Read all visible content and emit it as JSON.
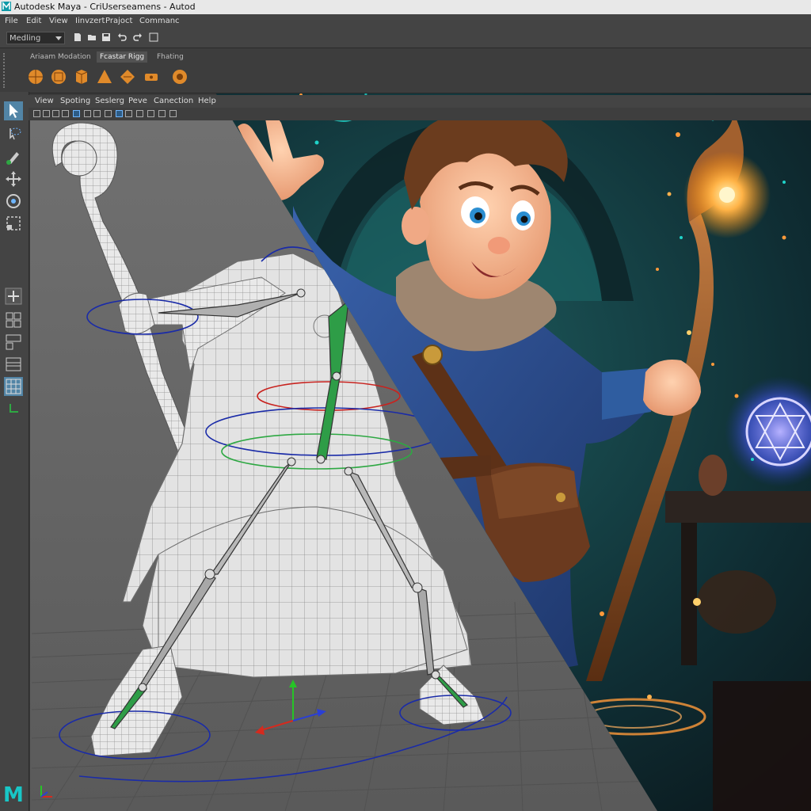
{
  "window": {
    "title": "Autodesk Maya - C:\\Users\\Name\\… - Autod",
    "display_title": "Autodesk Maya - CriUserseamens - Autod"
  },
  "menubar": {
    "items": [
      "File",
      "Edit",
      "View",
      "Iinvzert",
      "Prajoct",
      "Commanc"
    ]
  },
  "status_line": {
    "mode": "Medling"
  },
  "shelf": {
    "tabs": [
      "Ariaam Modation",
      "Fcastar Rigg",
      "Fhating"
    ],
    "active_tab": 1
  },
  "viewport_menu": {
    "items": [
      "View",
      "Spoting",
      "Seslerg",
      "Peve",
      "Canection",
      "Help"
    ]
  },
  "colors": {
    "maya_bg": "#444444",
    "viewport_bg": "#6b6b6b",
    "accent_blue": "#5285a6",
    "logo_cyan": "#18c7c7",
    "joint_green": "#2ea843",
    "ctrl_blue": "#1a2ba8",
    "ctrl_red": "#c8231f",
    "magic_teal": "#1fd3c9",
    "robe_blue": "#2a4a85",
    "staff_glow": "#ffb347"
  },
  "icons": {
    "toolbox": [
      "select-arrow-icon",
      "lasso-icon",
      "paint-select-icon",
      "move-icon",
      "rotate-icon",
      "scale-icon",
      "last-tool-icon",
      "layout-single-icon",
      "layout-four-icon",
      "layout-two-icon",
      "outliner-icon",
      "grid-icon"
    ],
    "shelf": [
      "sphere-icon",
      "cube-icon",
      "cylinder-icon",
      "cone-icon",
      "plane-icon",
      "torus-icon",
      "gear-icon"
    ]
  }
}
